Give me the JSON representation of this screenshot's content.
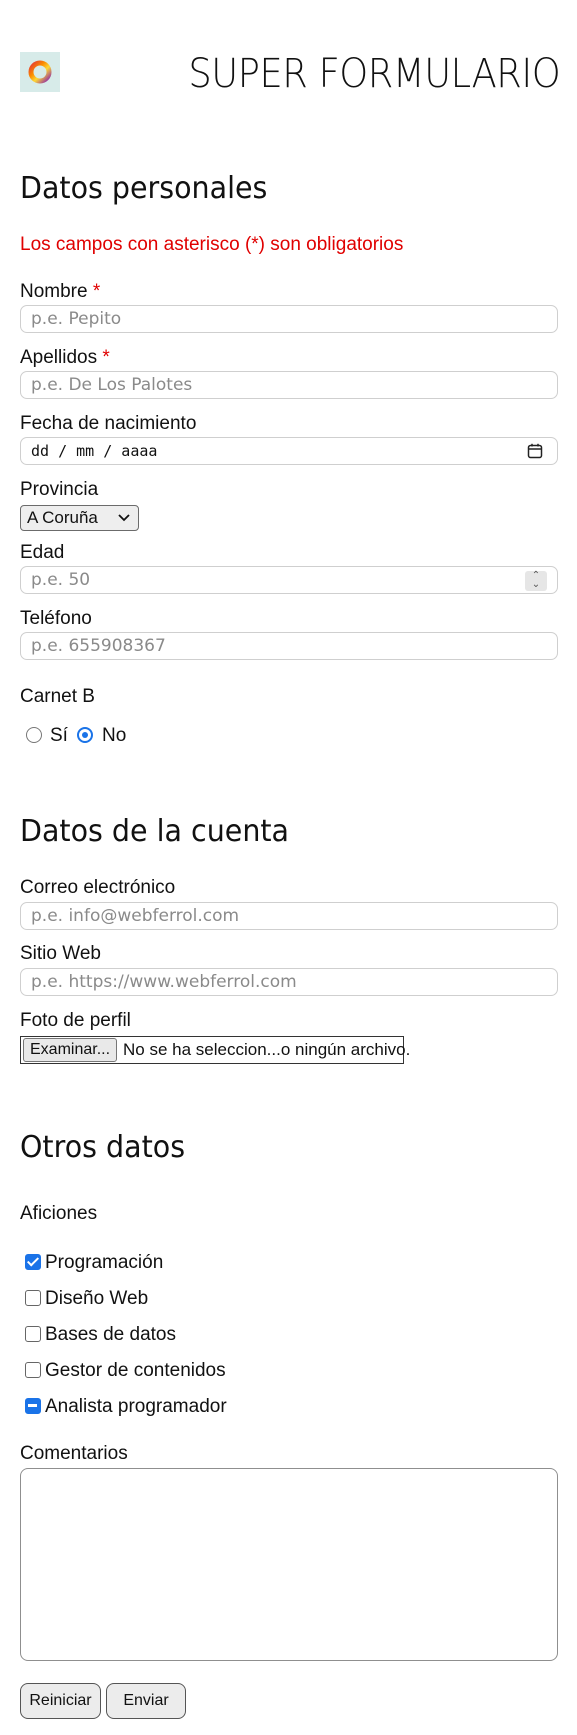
{
  "header": {
    "title": "SUPER FORMULARIO",
    "logo_icon": "ring-logo-icon"
  },
  "personal": {
    "heading": "Datos personales",
    "required_note": "Los campos con asterisco (*) son obligatorios",
    "nombre": {
      "label": "Nombre",
      "required_mark": "*",
      "placeholder": "p.e. Pepito"
    },
    "apellidos": {
      "label": "Apellidos",
      "required_mark": "*",
      "placeholder": "p.e. De Los Palotes"
    },
    "fecha": {
      "label": "Fecha de nacimiento",
      "placeholder": "dd / mm / aaaa"
    },
    "provincia": {
      "label": "Provincia",
      "selected": "A Coruña"
    },
    "edad": {
      "label": "Edad",
      "placeholder": "p.e. 50"
    },
    "telefono": {
      "label": "Teléfono",
      "placeholder": "p.e. 655908367"
    },
    "carnet": {
      "label": "Carnet B",
      "options": [
        "Sí",
        "No"
      ],
      "selected": "No"
    }
  },
  "account": {
    "heading": "Datos de la cuenta",
    "email": {
      "label": "Correo electrónico",
      "placeholder": "p.e. info@webferrol.com"
    },
    "web": {
      "label": "Sitio Web",
      "placeholder": "p.e. https://www.webferrol.com"
    },
    "foto": {
      "label": "Foto de perfil",
      "button": "Examinar...",
      "status": "No se ha seleccion...o ningún archivo."
    }
  },
  "other": {
    "heading": "Otros datos",
    "hobbies_label": "Aficiones",
    "hobbies": [
      {
        "label": "Programación",
        "state": "checked"
      },
      {
        "label": "Diseño Web",
        "state": "unchecked"
      },
      {
        "label": "Bases de datos",
        "state": "unchecked"
      },
      {
        "label": "Gestor de contenidos",
        "state": "unchecked"
      },
      {
        "label": "Analista programador",
        "state": "indeterminate"
      }
    ],
    "comments_label": "Comentarios"
  },
  "buttons": {
    "reset": "Reiniciar",
    "submit": "Enviar"
  },
  "colors": {
    "required": "#e00000",
    "accent": "#1a73e8"
  }
}
